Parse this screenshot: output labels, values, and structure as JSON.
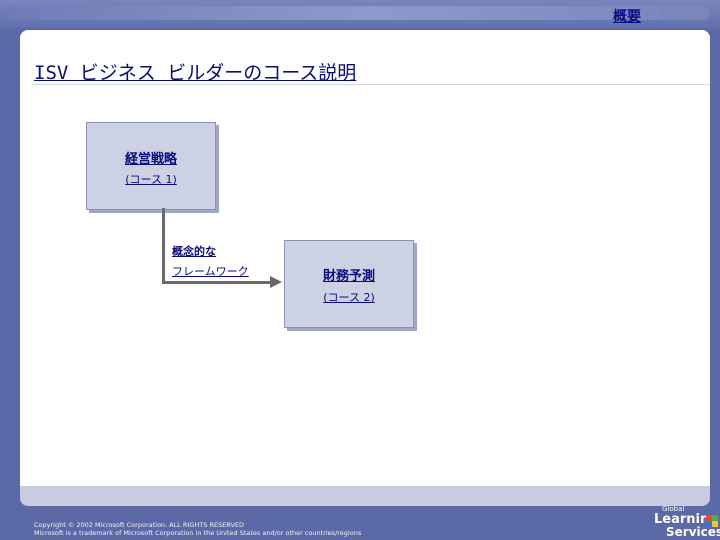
{
  "header": {
    "overview_link": "概要"
  },
  "slide": {
    "title": "ISV ビジネス ビルダーのコース説明",
    "box1": {
      "line1": "経営戦略",
      "line2": "(コース 1)"
    },
    "connector": {
      "line1": "概念的な",
      "line2": "フレームワーク"
    },
    "box2": {
      "line1": "財務予測",
      "line2": "(コース 2)"
    }
  },
  "footer": {
    "line1": "Copyright © 2002 Microsoft Corporation. ALL RIGHTS RESERVED",
    "line2": "Microsoft is a trademark of Microsoft Corporation in the United States and/or other countries/regions"
  },
  "logo": {
    "global": "Global",
    "learning": "Learning",
    "services": "Services"
  },
  "colors": {
    "background": "#5b6aa6",
    "link": "#0b0b80",
    "box_fill": "#ccd2e4"
  }
}
